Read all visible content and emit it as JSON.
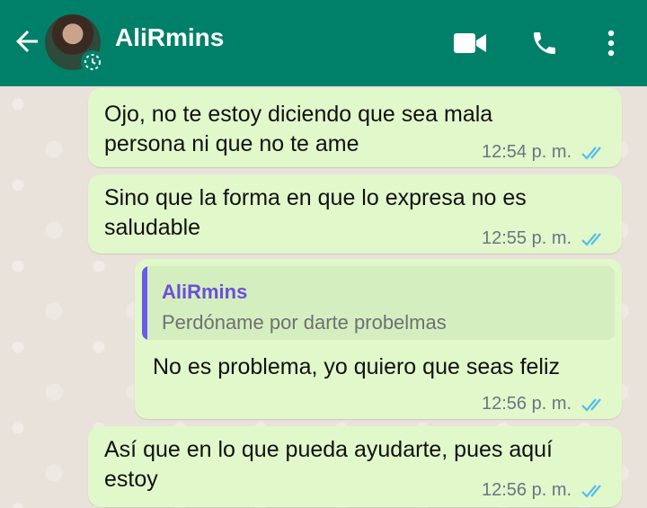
{
  "header": {
    "contact_name": "AliRmins",
    "icons": [
      "back-arrow-icon",
      "video-call-icon",
      "phone-icon",
      "more-vert-icon"
    ],
    "color": "#008069"
  },
  "messages": [
    {
      "text": "Ojo, no te estoy diciendo que sea mala persona ni que no te ame",
      "time": "12:54 p. m."
    },
    {
      "text": "Sino que la forma en que lo expresa no es saludable",
      "time": "12:55 p. m."
    },
    {
      "quote": {
        "author": "AliRmins",
        "text": "Perdóname por darte probelmas"
      },
      "text": "No es problema, yo quiero que seas feliz",
      "time": "12:56 p. m."
    },
    {
      "text": "Así que en lo que pueda ayudarte, pues aquí estoy",
      "time": "12:56 p. m."
    }
  ],
  "colors": {
    "bubble": "#E1F8CB",
    "read_ticks": "#53BDEB"
  }
}
